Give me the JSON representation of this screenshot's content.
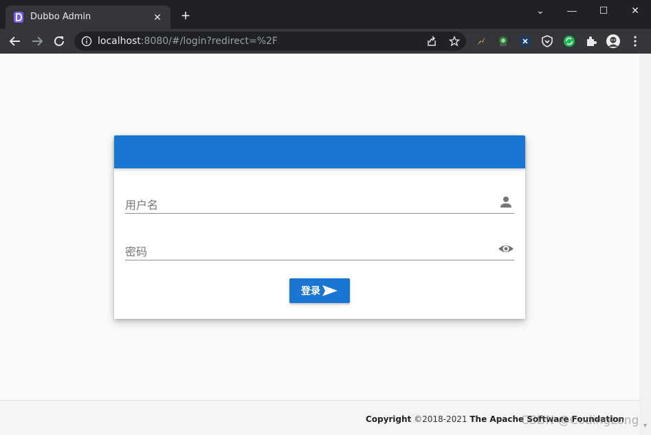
{
  "browser": {
    "tab_title": "Dubbo Admin",
    "tab_close": "✕",
    "new_tab": "+",
    "url_host": "localhost",
    "url_rest": ":8080/#/login?redirect=%2F",
    "window_controls": [
      "⌄",
      "—",
      "☐",
      "✕"
    ],
    "extensions": [
      "lightning-extension-icon",
      "lens-extension-icon",
      "x-extension-icon",
      "shield-extension-icon",
      "sync-extension-icon",
      "puzzle-icon",
      "profile-avatar"
    ]
  },
  "login": {
    "username_placeholder": "用户名",
    "password_placeholder": "密码",
    "submit_label": "登录",
    "header_color": "#1976d2"
  },
  "footer": {
    "copyright_label": "Copyright",
    "years": "©2018-2021",
    "org": "The Apache Software Foundation"
  },
  "watermark": "CSDN @CodingLong"
}
